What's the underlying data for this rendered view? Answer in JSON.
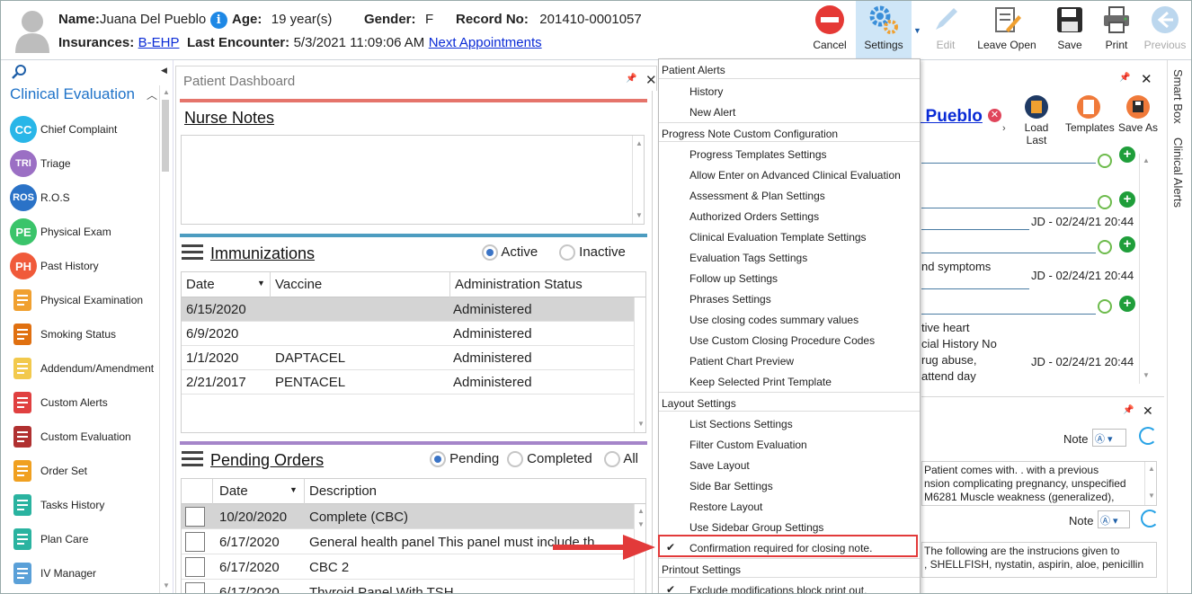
{
  "patient": {
    "name_label": "Name:",
    "name": "Juana Del Pueblo",
    "age_label": "Age:",
    "age": "19 year(s)",
    "gender_label": "Gender:",
    "gender": "F",
    "record_label": "Record No:",
    "record": "201410-0001057",
    "ins_label": "Insurances:",
    "insurance": "B-EHP",
    "last_enc_label": "Last Encounter:",
    "last_enc": "5/3/2021 11:09:06 AM",
    "next_appt": "Next Appointments"
  },
  "toolbar": {
    "cancel": "Cancel",
    "settings": "Settings",
    "edit": "Edit",
    "leave_open": "Leave Open",
    "save": "Save",
    "print": "Print",
    "previous": "Previous"
  },
  "sidebar": {
    "title": "Clinical Evaluation",
    "items": [
      {
        "label": "Chief Complaint",
        "abbr": "CC",
        "color": "#29b6e8"
      },
      {
        "label": "Triage",
        "abbr": "TRI",
        "color": "#9b6fc4"
      },
      {
        "label": "R.O.S",
        "abbr": "ROS",
        "color": "#2a72c7"
      },
      {
        "label": "Physical Exam",
        "abbr": "PE",
        "color": "#3ac46a"
      },
      {
        "label": "Past History",
        "abbr": "PH",
        "color": "#f05a3a"
      },
      {
        "label": "Physical Examination",
        "abbr": "",
        "color": "#f0a030"
      },
      {
        "label": "Smoking Status",
        "abbr": "",
        "color": "#e07010"
      },
      {
        "label": "Addendum/Amendment",
        "abbr": "",
        "color": "#f2c94c"
      },
      {
        "label": "Custom Alerts",
        "abbr": "",
        "color": "#e04040"
      },
      {
        "label": "Custom Evaluation",
        "abbr": "",
        "color": "#b03030"
      },
      {
        "label": "Order Set",
        "abbr": "",
        "color": "#f0a020"
      },
      {
        "label": "Tasks History",
        "abbr": "",
        "color": "#2ab3a0"
      },
      {
        "label": "Plan Care",
        "abbr": "",
        "color": "#2ab3a0"
      },
      {
        "label": "IV Manager",
        "abbr": "",
        "color": "#5aa0d8"
      }
    ]
  },
  "dashboard": {
    "title": "Patient Dashboard",
    "nurse_notes": "Nurse Notes",
    "immunizations": {
      "title": "Immunizations",
      "active": "Active",
      "inactive": "Inactive",
      "headers": [
        "Date",
        "Vaccine",
        "Administration Status"
      ],
      "rows": [
        [
          "6/15/2020",
          "",
          "Administered"
        ],
        [
          "6/9/2020",
          "",
          "Administered"
        ],
        [
          "1/1/2020",
          "DAPTACEL",
          "Administered"
        ],
        [
          "2/21/2017",
          "PENTACEL",
          "Administered"
        ]
      ]
    },
    "orders": {
      "title": "Pending Orders",
      "pending": "Pending",
      "completed": "Completed",
      "all": "All",
      "headers": [
        "Date",
        "Description"
      ],
      "rows": [
        [
          "10/20/2020",
          "Complete (CBC)"
        ],
        [
          "6/17/2020",
          "General health panel This panel must include th"
        ],
        [
          "6/17/2020",
          "CBC 2"
        ],
        [
          "6/17/2020",
          "Thyroid Panel With TSH"
        ]
      ]
    }
  },
  "menu": {
    "groups": [
      {
        "title": "Patient Alerts",
        "items": [
          {
            "label": "History"
          },
          {
            "label": "New Alert"
          }
        ]
      },
      {
        "title": "Progress Note Custom Configuration",
        "items": [
          {
            "label": "Progress Templates Settings"
          },
          {
            "label": "Allow Enter on Advanced Clinical Evaluation"
          },
          {
            "label": "Assessment & Plan Settings"
          },
          {
            "label": "Authorized Orders Settings"
          },
          {
            "label": "Clinical Evaluation Template Settings"
          },
          {
            "label": "Evaluation Tags Settings"
          },
          {
            "label": "Follow up Settings"
          },
          {
            "label": "Phrases Settings"
          },
          {
            "label": "Use closing codes summary values"
          },
          {
            "label": "Use Custom Closing Procedure Codes"
          },
          {
            "label": "Patient Chart Preview"
          },
          {
            "label": "Keep Selected Print Template"
          }
        ]
      },
      {
        "title": "Layout Settings",
        "items": [
          {
            "label": "List Sections Settings"
          },
          {
            "label": "Filter Custom Evaluation"
          },
          {
            "label": "Save Layout"
          },
          {
            "label": "Side Bar Settings"
          },
          {
            "label": "Restore Layout"
          },
          {
            "label": "Use Sidebar Group Settings"
          },
          {
            "label": "Confirmation required for closing note.",
            "checked": true
          }
        ]
      },
      {
        "title": "Printout Settings",
        "items": [
          {
            "label": "Exclude modifications block print out.",
            "checked": true
          }
        ]
      }
    ]
  },
  "right": {
    "name_fragment": "l Pueblo",
    "load_last": "Load Last",
    "templates": "Templates",
    "save_as": "Save As",
    "stamp": "JD - 02/24/21 20:44",
    "symptoms": "nd symptoms",
    "hist": [
      "tive heart",
      "cial History No",
      "rug abuse,",
      "attend day"
    ],
    "note_label": "Note",
    "note1": [
      "Patient comes with. .    with a previous",
      "nsion complicating pregnancy, unspecified",
      "M6281 Muscle weakness (generalized),"
    ],
    "note2": [
      "The following are the instrucions given to",
      ", SHELLFISH, nystatin, aspirin, aloe, penicillin"
    ]
  },
  "rightbar": {
    "smart_box": "Smart Box",
    "clinical_alerts": "Clinical Alerts"
  }
}
